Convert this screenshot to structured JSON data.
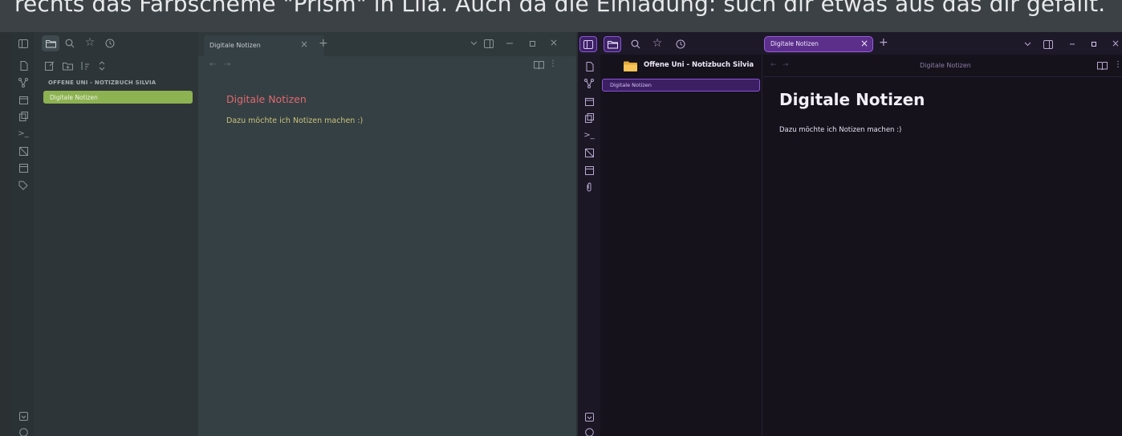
{
  "caption": "rechts das Farbscheme \"Prism\" in Lila. Auch da die Einladung: such dir etwas aus das dir gefällt.",
  "left_window": {
    "tab_title": "Digitale Notizen",
    "tab_close": "×",
    "tab_add": "+",
    "vault_name": "OFFENE UNI - NOTIZBUCH SILVIA",
    "selected_file": "Digitale Notizen",
    "note_title": "Digitale Notizen",
    "note_body": "Dazu möchte ich Notizen machen :)",
    "colors": {
      "background": "#354044",
      "accent": "#8db252",
      "title": "#e0686f",
      "body": "#c9c37a"
    }
  },
  "right_window": {
    "tab_title": "Digitale Notizen",
    "tab_close": "×",
    "tab_add": "+",
    "vault_name": "Offene Uni - Notizbuch Silvia",
    "selected_file": "Digitale Notizen",
    "view_title": "Digitale Notizen",
    "note_title": "Digitale Notizen",
    "note_body": "Dazu möchte ich Notizen machen :)",
    "colors": {
      "background": "#15121c",
      "accent": "#8b54d6",
      "title": "#f2eff8"
    }
  },
  "icons": {
    "sidebar_toggle": "sidebar-toggle-icon",
    "folder": "folder-icon",
    "search": "search-icon",
    "star": "star-icon",
    "clock": "clock-icon",
    "chevron": "chevron-down-icon",
    "split": "split-view-icon",
    "minimize": "minimize-icon",
    "maximize": "maximize-icon",
    "close": "close-icon"
  }
}
